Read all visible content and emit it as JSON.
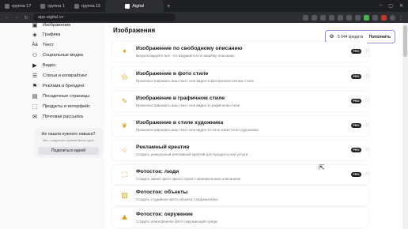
{
  "browser": {
    "tabs": [
      {
        "label": "группа 17",
        "active": false
      },
      {
        "label": "группа 1",
        "active": false
      },
      {
        "label": "группа 15",
        "active": false
      },
      {
        "label": "Aigital",
        "active": true
      }
    ],
    "url": "app.aigital.co"
  },
  "sidebar": {
    "items": [
      {
        "label": "Изображения",
        "icon": "image-icon"
      },
      {
        "label": "Графика",
        "icon": "graphics-icon"
      },
      {
        "label": "Текст",
        "icon": "text-icon"
      },
      {
        "label": "Социальные медиа",
        "icon": "social-icon"
      },
      {
        "label": "Видео",
        "icon": "video-icon"
      },
      {
        "label": "Статьи и копирайтинг",
        "icon": "article-icon"
      },
      {
        "label": "Реклама и брендинг",
        "icon": "ads-icon"
      },
      {
        "label": "Посадочные страницы",
        "icon": "landing-icon"
      },
      {
        "label": "Продукты и интерфейс",
        "icon": "product-icon"
      },
      {
        "label": "Почтовая рассылка",
        "icon": "mail-icon"
      }
    ],
    "promo": {
      "title": "Не нашли нужного навыка?",
      "subtitle": "Мы с радостью примем ваши идеи",
      "button": "Поделиться идеей"
    }
  },
  "main": {
    "section_title": "Изображения",
    "credits": {
      "amount": "5 044 кредита",
      "topup": "Пополнить"
    },
    "cards": [
      {
        "title": "Изображение по свободному описанию",
        "desc": "Визуализируйте всё, что вздумается по вашему описанию",
        "badge": "PRO",
        "icon": "wand-icon"
      },
      {
        "title": "Изображение в фото стиле",
        "desc": "Проиллюстрировать ваш текст или видео в фотореалистичном стиле",
        "badge": "PRO",
        "icon": "camera-icon"
      },
      {
        "title": "Изображение в графичном стиле",
        "desc": "Проиллюстрировать ваш текст или видео в графичном стиле",
        "badge": "PRO",
        "icon": "brush-icon"
      },
      {
        "title": "Изображение в стиле художника",
        "desc": "Проиллюстрировать ваш текст или видео в стиле известного художника",
        "badge": "PRO",
        "icon": "palette-icon"
      },
      {
        "title": "Рекламный креатив",
        "desc": "Создать уникальный рекламный креатив для продукта или услуги",
        "badge": "PRO",
        "icon": "star-icon"
      },
      {
        "title": "Фотосток: люди",
        "desc": "Создать живое фото яркого героя с минимальным описанием",
        "badge": "PRO",
        "icon": "person-icon"
      },
      {
        "title": "Фотосток: объекты",
        "desc": "Создать студийное фото объекта с выразительн",
        "badge": "",
        "icon": "box-icon"
      },
      {
        "title": "Фотосток: окружение",
        "desc": "Создать атмосферное фото окружающей среды",
        "badge": "",
        "icon": "landscape-icon"
      }
    ]
  },
  "colors": {
    "accent_border": "#9b87d6",
    "icon_gold": "#d9a21b",
    "pro_badge": "#1c1c1c"
  }
}
